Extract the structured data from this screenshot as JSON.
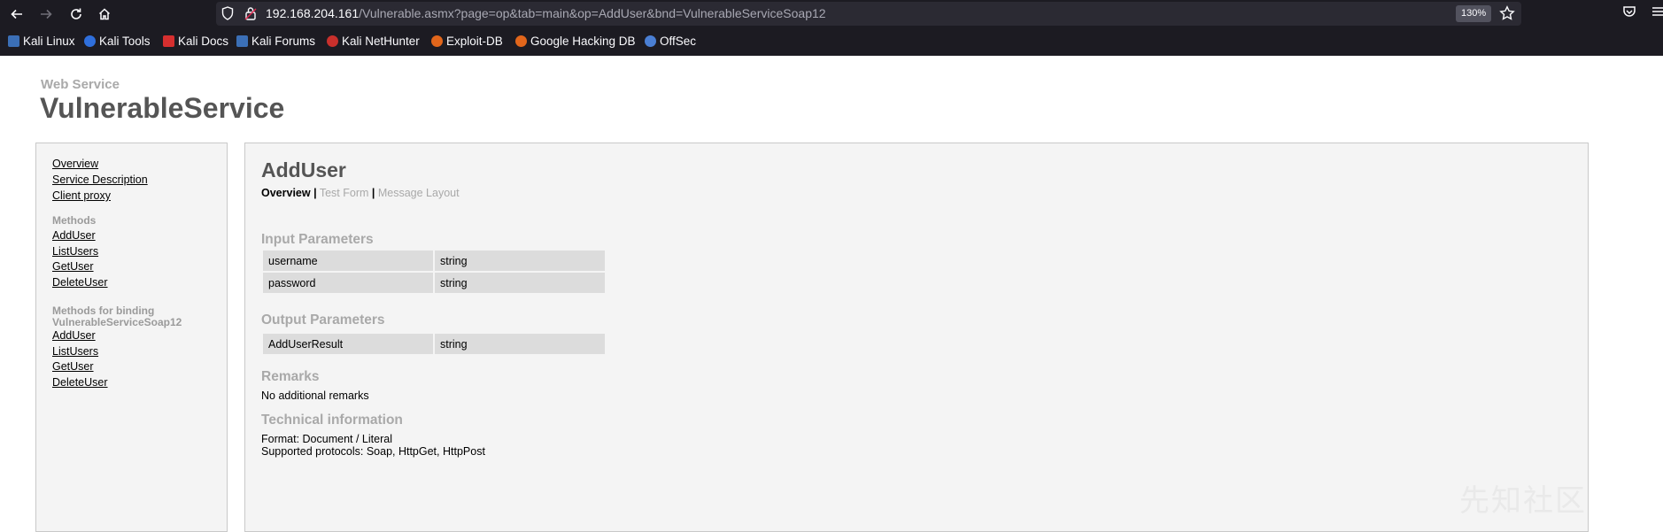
{
  "browser": {
    "url_host": "192.168.204.161",
    "url_path": "/Vulnerable.asmx?page=op&tab=main&op=AddUser&bnd=VulnerableServiceSoap12",
    "zoom": "130%"
  },
  "bookmarks": [
    {
      "label": "Kali Linux",
      "icon": "kali-dragon-icon",
      "color": "#3b6fb6"
    },
    {
      "label": "Kali Tools",
      "icon": "kali-tools-icon",
      "color": "#2f6fdc"
    },
    {
      "label": "Kali Docs",
      "icon": "kali-docs-icon",
      "color": "#d62f2f"
    },
    {
      "label": "Kali Forums",
      "icon": "kali-forums-icon",
      "color": "#3b6fb6"
    },
    {
      "label": "Kali NetHunter",
      "icon": "nethunter-icon",
      "color": "#c9302c"
    },
    {
      "label": "Exploit-DB",
      "icon": "exploit-db-icon",
      "color": "#e2661b"
    },
    {
      "label": "Google Hacking DB",
      "icon": "ghdb-icon",
      "color": "#e2661b"
    },
    {
      "label": "OffSec",
      "icon": "offsec-icon",
      "color": "#4a7fd4"
    }
  ],
  "page": {
    "subtitle": "Web Service",
    "title": "VulnerableService"
  },
  "sidebar": {
    "links": [
      "Overview",
      "Service Description",
      "Client proxy"
    ],
    "methods_heading": "Methods",
    "methods": [
      "AddUser",
      "ListUsers",
      "GetUser",
      "DeleteUser"
    ],
    "binding_heading_line1": "Methods for binding",
    "binding_heading_line2": "VulnerableServiceSoap12",
    "binding_methods": [
      "AddUser",
      "ListUsers",
      "GetUser",
      "DeleteUser"
    ]
  },
  "operation": {
    "title": "AddUser",
    "tabs": {
      "overview": "Overview",
      "sep1": "|",
      "test_form": "Test Form",
      "sep2": "|",
      "message_layout": "Message Layout"
    },
    "input_heading": "Input Parameters",
    "input_params": [
      {
        "name": "username",
        "type": "string"
      },
      {
        "name": "password",
        "type": "string"
      }
    ],
    "output_heading": "Output Parameters",
    "output_params": [
      {
        "name": "AddUserResult",
        "type": "string"
      }
    ],
    "remarks_heading": "Remarks",
    "remarks": "No additional remarks",
    "tech_heading": "Technical information",
    "format": "Format: Document / Literal",
    "protocols": "Supported protocols: Soap, HttpGet, HttpPost"
  },
  "watermark": "先知社区"
}
